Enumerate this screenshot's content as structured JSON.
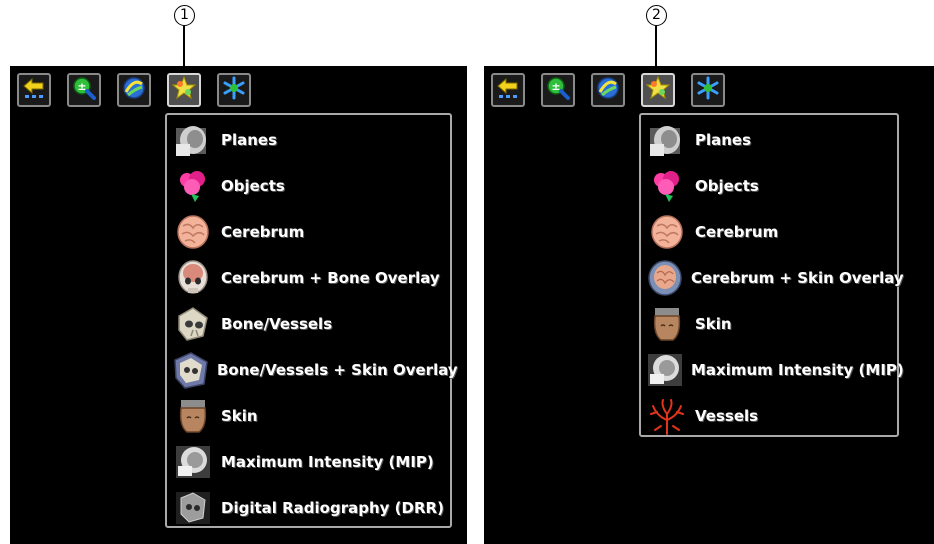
{
  "callouts": [
    "1",
    "2"
  ],
  "panels": [
    {
      "toolbar": [
        {
          "icon": "back-arrow-icon"
        },
        {
          "icon": "zoom-icon"
        },
        {
          "icon": "rotate-icon"
        },
        {
          "icon": "render-mode-icon",
          "active": true
        },
        {
          "icon": "snowflake-icon"
        }
      ],
      "menu_items": [
        {
          "label": "Planes",
          "icon": "planes-icon"
        },
        {
          "label": "Objects",
          "icon": "objects-icon"
        },
        {
          "label": "Cerebrum",
          "icon": "cerebrum-icon"
        },
        {
          "label": "Cerebrum + Bone Overlay",
          "icon": "cerebrum-bone-overlay-icon"
        },
        {
          "label": "Bone/Vessels",
          "icon": "bone-vessels-icon"
        },
        {
          "label": "Bone/Vessels + Skin Overlay",
          "icon": "bone-vessels-skin-overlay-icon"
        },
        {
          "label": "Skin",
          "icon": "skin-icon"
        },
        {
          "label": "Maximum Intensity (MIP)",
          "icon": "mip-icon"
        },
        {
          "label": "Digital Radiography (DRR)",
          "icon": "drr-icon"
        }
      ]
    },
    {
      "toolbar": [
        {
          "icon": "back-arrow-icon"
        },
        {
          "icon": "zoom-icon"
        },
        {
          "icon": "rotate-icon"
        },
        {
          "icon": "render-mode-icon",
          "active": true
        },
        {
          "icon": "snowflake-icon"
        }
      ],
      "menu_items": [
        {
          "label": "Planes",
          "icon": "planes-icon"
        },
        {
          "label": "Objects",
          "icon": "objects-icon"
        },
        {
          "label": "Cerebrum",
          "icon": "cerebrum-icon"
        },
        {
          "label": "Cerebrum + Skin Overlay",
          "icon": "cerebrum-skin-overlay-icon"
        },
        {
          "label": "Skin",
          "icon": "skin-icon"
        },
        {
          "label": "Maximum Intensity (MIP)",
          "icon": "mip-icon"
        },
        {
          "label": "Vessels",
          "icon": "vessels-icon"
        }
      ]
    }
  ]
}
